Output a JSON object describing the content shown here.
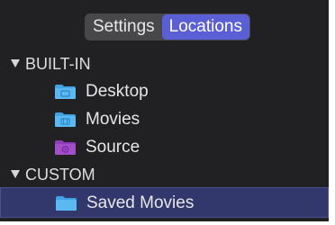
{
  "tabs": {
    "settings_label": "Settings",
    "locations_label": "Locations",
    "active": "Locations"
  },
  "sections": [
    {
      "title": "BUILT-IN",
      "expanded": true,
      "items": [
        {
          "label": "Desktop",
          "icon": "folder-desktop-icon",
          "color": "#3fa3e6"
        },
        {
          "label": "Movies",
          "icon": "folder-movies-icon",
          "color": "#3fa3e6"
        },
        {
          "label": "Source",
          "icon": "folder-source-icon",
          "color": "#a24fc9"
        }
      ]
    },
    {
      "title": "CUSTOM",
      "expanded": true,
      "items": [
        {
          "label": "Saved Movies",
          "icon": "folder-icon",
          "color": "#3fa3e6",
          "selected": true
        }
      ]
    }
  ],
  "colors": {
    "background": "#212123",
    "segmented_bg": "#48484b",
    "accent": "#5a5fd6",
    "selection": "#33386c"
  }
}
